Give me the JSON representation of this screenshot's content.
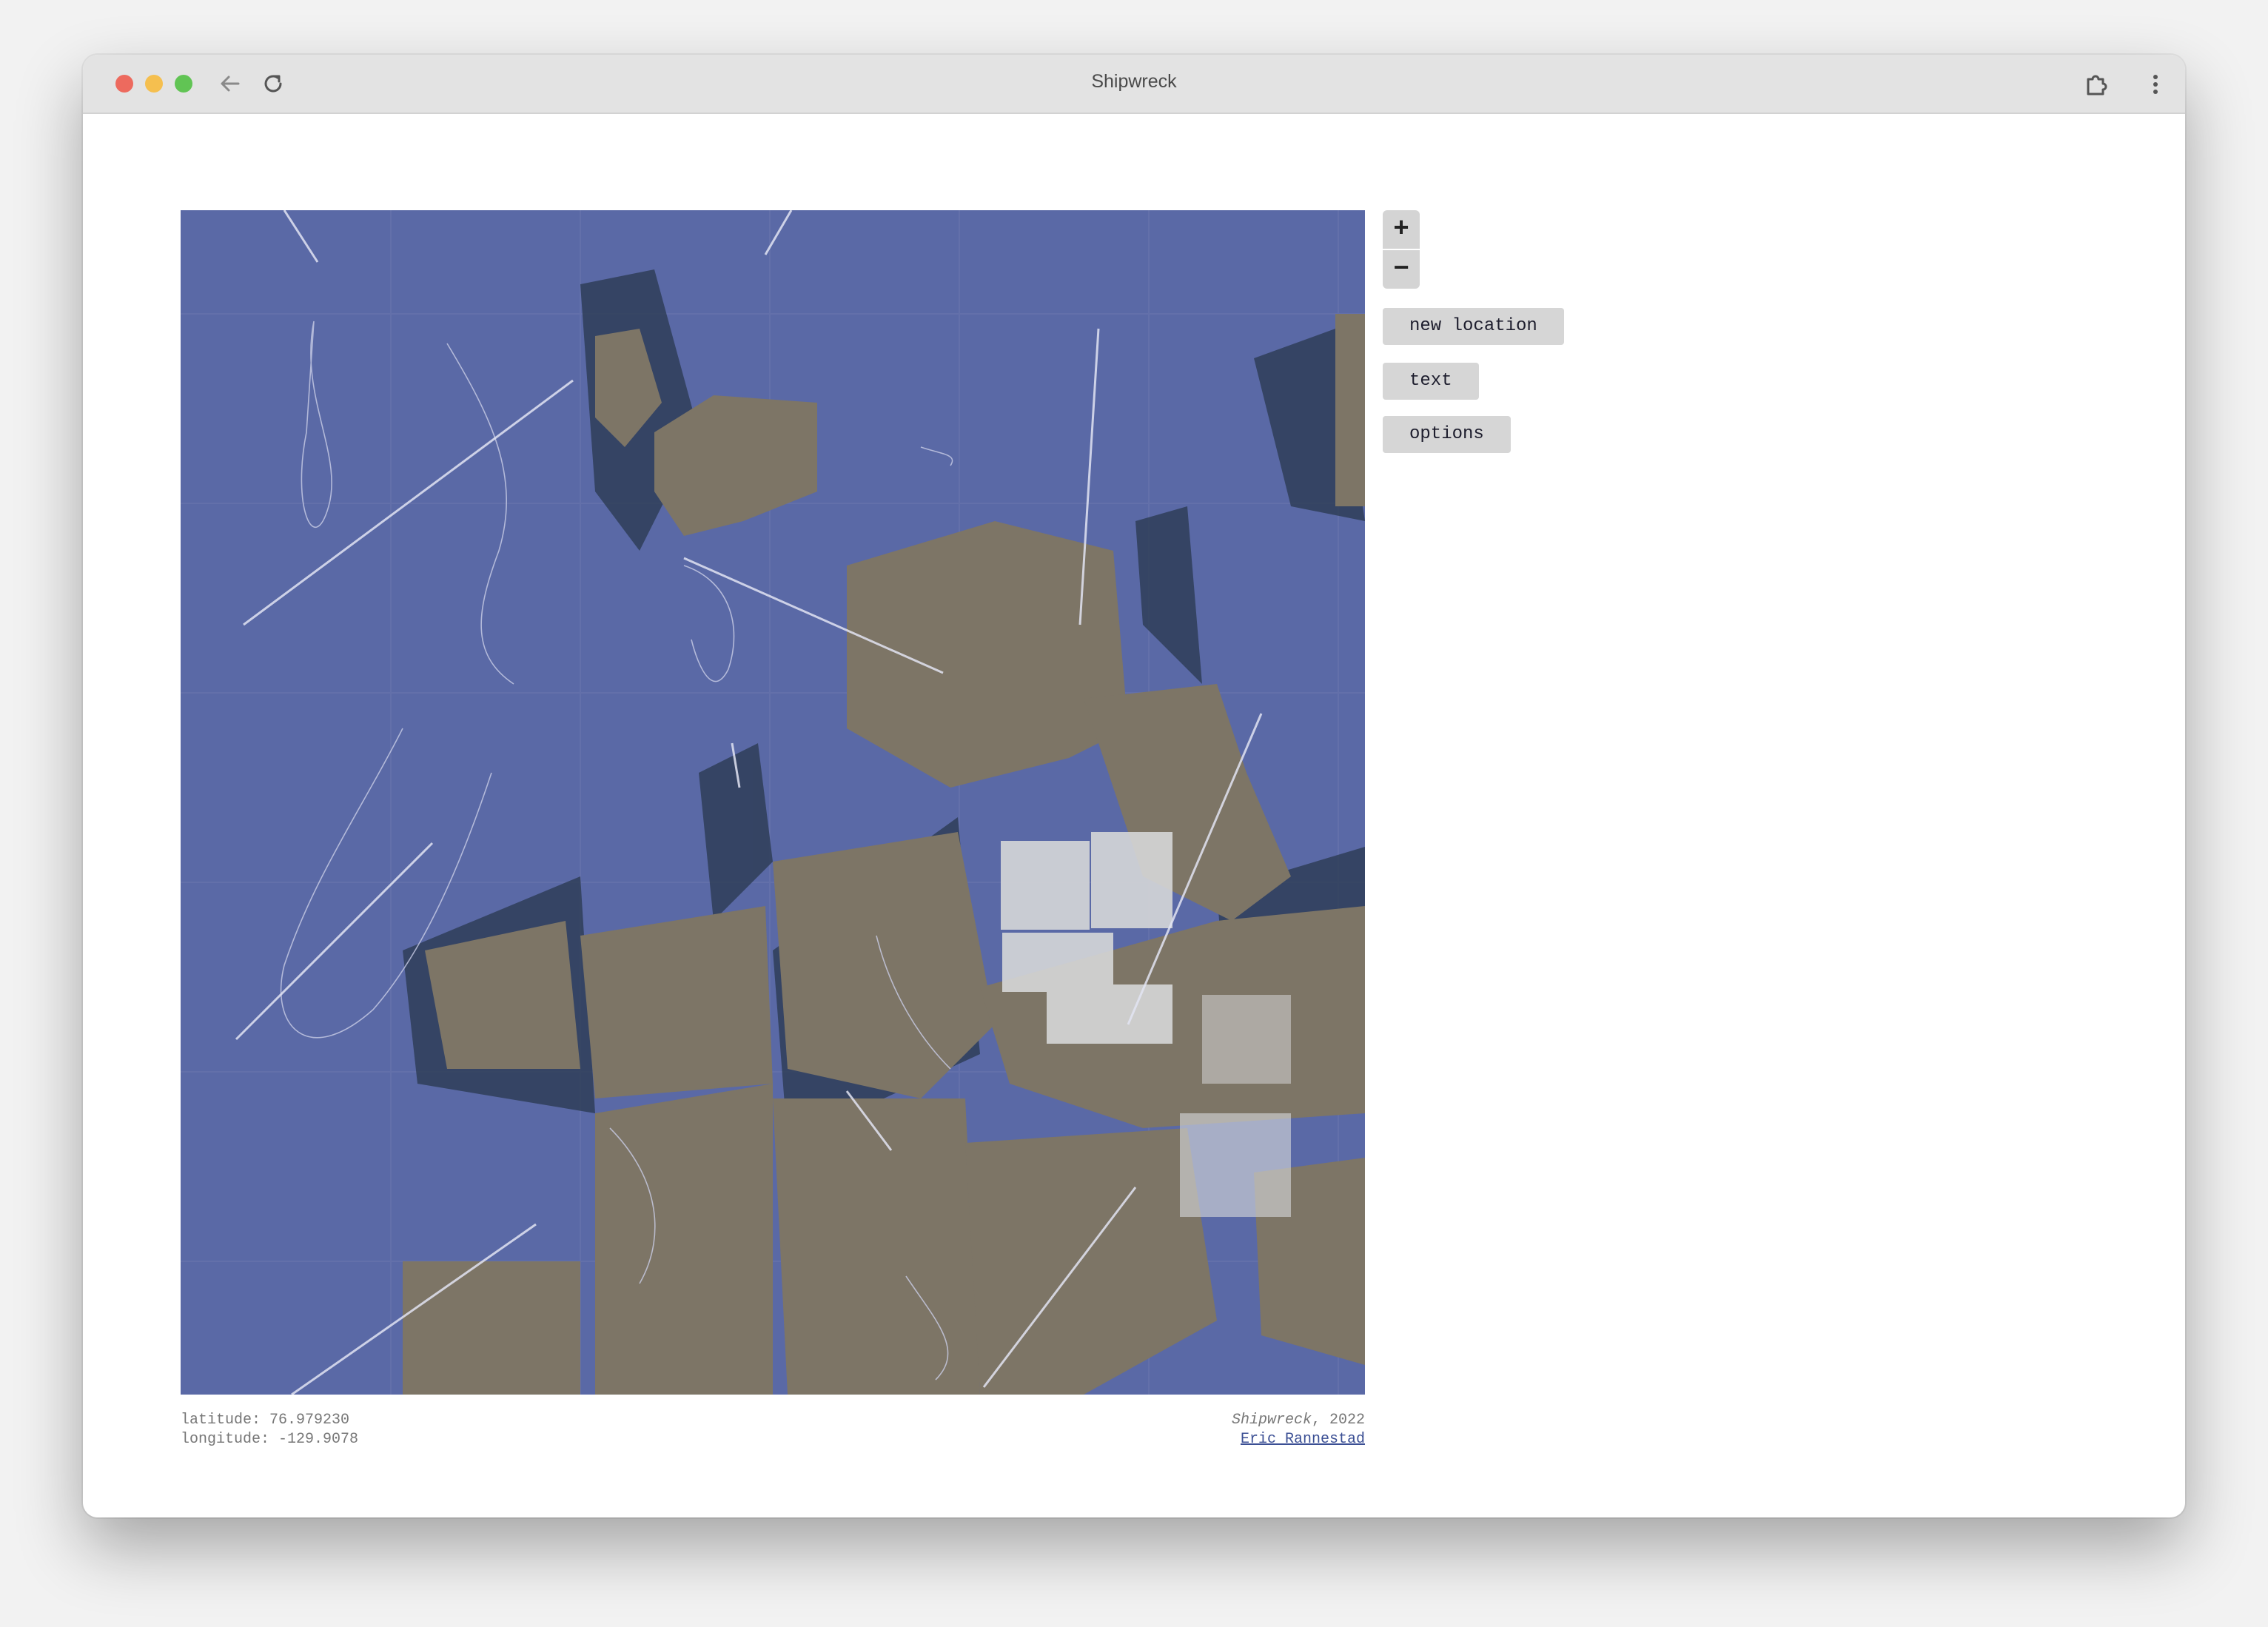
{
  "window": {
    "title": "Shipwreck"
  },
  "controls": {
    "zoom_in": "+",
    "zoom_out": "−",
    "new_location": "new location",
    "text": "text",
    "options": "options"
  },
  "coordinates": {
    "latitude": "latitude: 76.979230",
    "longitude": "longitude: -129.9078"
  },
  "credit": {
    "work_title": "Shipwreck",
    "year": ", 2022",
    "artist": "Eric Rannestad"
  },
  "colors": {
    "water": "#5a69a6",
    "land": "#7d7566",
    "deep": "#2d3d56"
  }
}
